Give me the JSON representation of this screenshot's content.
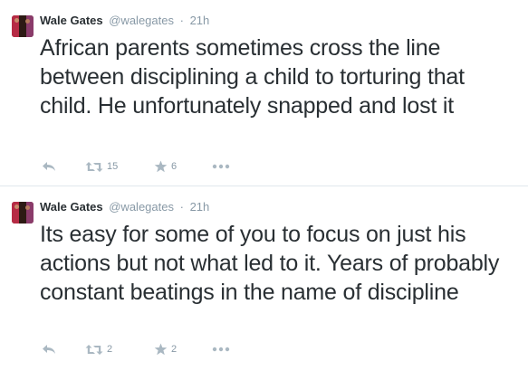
{
  "tweets": [
    {
      "name": "Wale Gates",
      "handle": "@walegates",
      "separator": "·",
      "time": "21h",
      "text": "African parents sometimes cross the line between disciplining a child to torturing that child. He unfortunately snapped and lost it",
      "retweets": "15",
      "favorites": "6"
    },
    {
      "name": "Wale Gates",
      "handle": "@walegates",
      "separator": "·",
      "time": "21h",
      "text": "Its easy for some of you to focus on just his actions but not what led to it. Years of probably constant beatings in the name of discipline",
      "retweets": "2",
      "favorites": "2"
    }
  ],
  "icons": {
    "reply": "reply-icon",
    "retweet": "retweet-icon",
    "favorite": "star-icon",
    "more": "more-icon"
  },
  "colors": {
    "text": "#292f33",
    "muted": "#8899a6",
    "icon": "#aab8c2",
    "divider": "#e1e8ed"
  }
}
